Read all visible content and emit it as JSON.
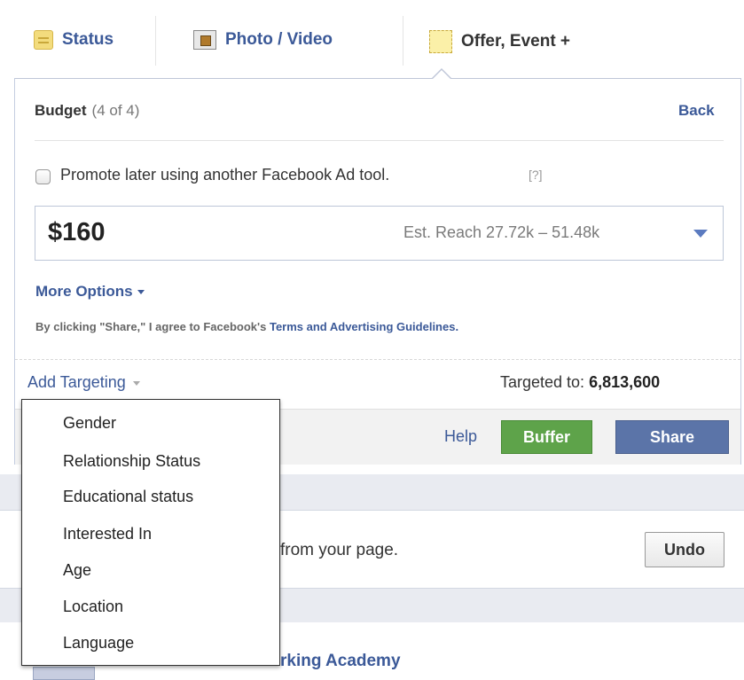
{
  "tabs": {
    "status": "Status",
    "photo_video": "Photo / Video",
    "offer_event": "Offer, Event +"
  },
  "budget": {
    "title": "Budget",
    "step": "(4 of 4)",
    "back": "Back",
    "promote_later": "Promote later using another Facebook Ad tool.",
    "help_mark": "[?]",
    "amount": "$160",
    "reach": "Est. Reach 27.72k – 51.48k",
    "more_options": "More Options",
    "terms_prefix": "By clicking \"Share,\" I agree to Facebook's ",
    "terms_link": "Terms and Advertising Guidelines."
  },
  "targeting": {
    "add_label": "Add Targeting",
    "targeted_label": "Targeted to:",
    "targeted_count": "6,813,600"
  },
  "footer": {
    "help": "Help",
    "buffer": "Buffer",
    "share": "Share"
  },
  "dropdown": {
    "items": [
      "Gender",
      "Relationship Status",
      "Educational status",
      "Interested In",
      "Age",
      "Location",
      "Language"
    ]
  },
  "feed": {
    "from_page": "from your page.",
    "undo": "Undo",
    "academy_fragment": "rking Academy"
  },
  "colors": {
    "link_blue": "#3b5998",
    "buffer_green": "#5ea34a",
    "share_blue": "#5b74a8"
  }
}
